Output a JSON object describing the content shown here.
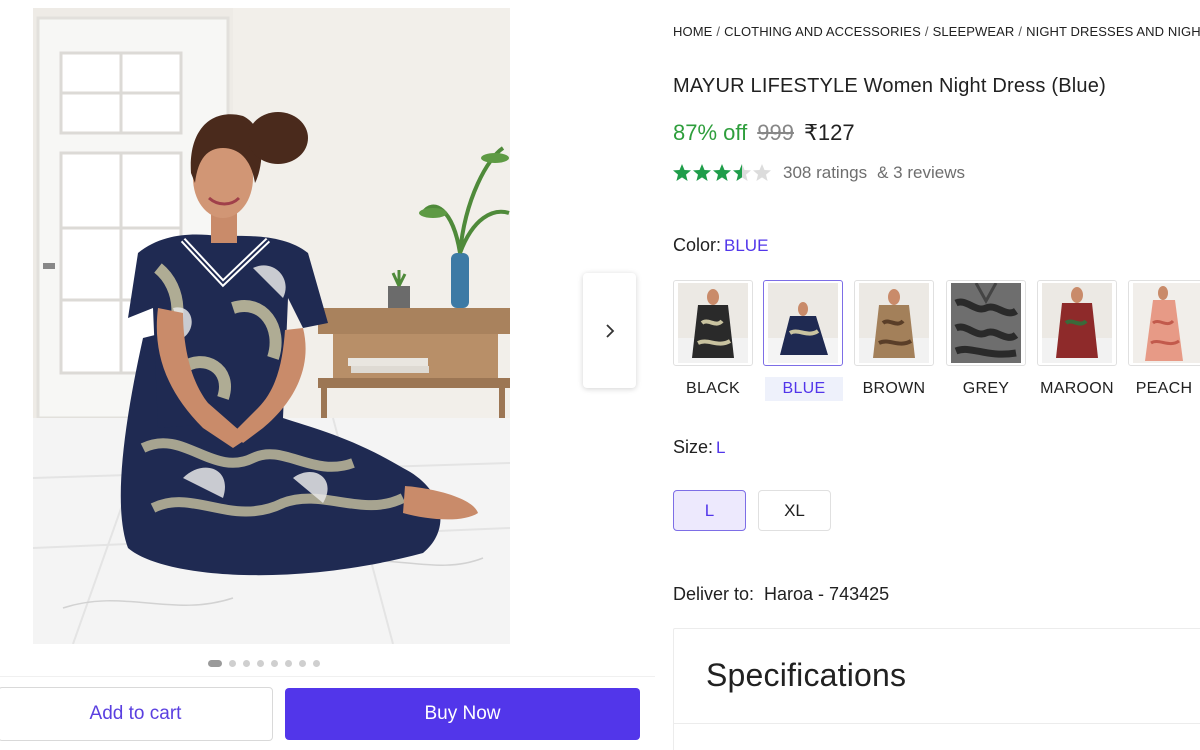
{
  "product": {
    "breadcrumb": [
      "HOME",
      "CLOTHING AND ACCESSORIES",
      "SLEEPWEAR",
      "NIGHT DRESSES AND NIGHTIES"
    ],
    "title": "MAYUR LIFESTYLE Women Night Dress (Blue)",
    "discount": "87% off",
    "mrp": "999",
    "price": "₹127",
    "rating_value": 3.5,
    "ratings_text": "308 ratings",
    "reviews_text": "& 3 reviews"
  },
  "gallery": {
    "total_images": 8,
    "active_index": 0
  },
  "color": {
    "label": "Color:",
    "selected": "BLUE",
    "options": [
      "BLACK",
      "BLUE",
      "BROWN",
      "GREY",
      "MAROON",
      "PEACH"
    ]
  },
  "size": {
    "label": "Size:",
    "selected": "L",
    "options": [
      "L",
      "XL"
    ]
  },
  "delivery": {
    "label": "Deliver to:",
    "location": "Haroa - 743425"
  },
  "specifications": {
    "title": "Specifications"
  },
  "actions": {
    "add_to_cart": "Add to cart",
    "buy_now": "Buy Now"
  },
  "colors": {
    "accent": "#5236ea",
    "discount_green": "#2e9e3c",
    "star_green": "#1f9d4a"
  }
}
